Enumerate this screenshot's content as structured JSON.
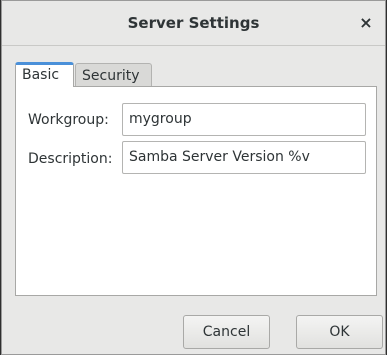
{
  "window": {
    "title": "Server Settings",
    "close_glyph": "×"
  },
  "tabs": [
    {
      "label": "Basic",
      "active": true
    },
    {
      "label": "Security",
      "active": false
    }
  ],
  "form": {
    "workgroup_label": "Workgroup:",
    "workgroup_value": "mygroup",
    "description_label": "Description:",
    "description_value": "Samba Server Version %v"
  },
  "buttons": {
    "cancel": "Cancel",
    "ok": "OK"
  },
  "colors": {
    "accent": "#4a90d9",
    "background": "#e8e8e7"
  }
}
